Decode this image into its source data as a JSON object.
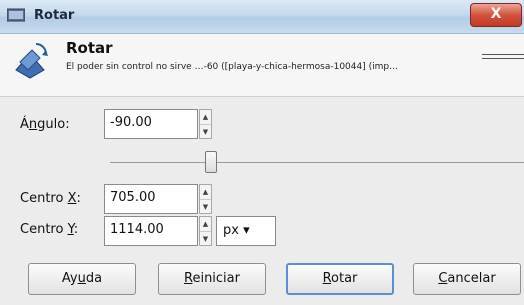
{
  "window": {
    "title": "Rotar",
    "close_glyph": "X"
  },
  "header": {
    "title": "Rotar",
    "subtitle": "El poder sin control no sirve …-60 ([playa-y-chica-hermosa-10044] (imp…"
  },
  "angle": {
    "label_prefix": "Á",
    "label_accel": "n",
    "label_rest": "gulo:",
    "value": "-90.00"
  },
  "center_x": {
    "label_prefix": "Centro ",
    "label_accel": "X",
    "label_rest": ":",
    "value": "705.00"
  },
  "center_y": {
    "label_prefix": "Centro ",
    "label_accel": "Y",
    "label_rest": ":",
    "value": "1114.00"
  },
  "unit": {
    "selected": "px"
  },
  "buttons": {
    "help": {
      "pre": "Ay",
      "accel": "u",
      "post": "da"
    },
    "reset": {
      "pre": "",
      "accel": "R",
      "post": "einiciar"
    },
    "rotate": {
      "pre": "",
      "accel": "R",
      "post": "otar"
    },
    "cancel": {
      "pre": "",
      "accel": "C",
      "post": "ancelar"
    }
  },
  "colors": {
    "close": "#c9442d",
    "default_border": "#5b8fcf"
  }
}
